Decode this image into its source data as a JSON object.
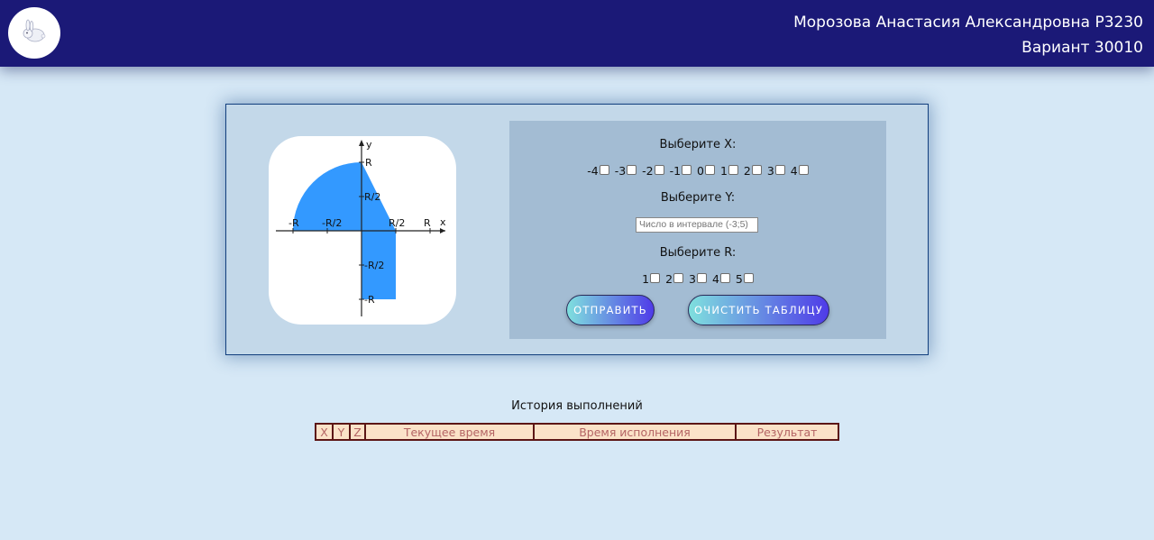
{
  "header": {
    "name": "Морозова Анастасия Александровна P3230",
    "variant": "Вариант 30010",
    "logo_icon": "rabbit-icon"
  },
  "graph": {
    "axis_y": "y",
    "axis_x": "x",
    "label_R_top": "R",
    "label_R2_top": "R/2",
    "label_neg_R": "-R",
    "label_neg_R2_x": "-R/2",
    "label_R2_x": "R/2",
    "label_R_x": "R",
    "label_neg_R2_y": "-R/2",
    "label_neg_R_y": "-R",
    "fill_color": "#3399ff"
  },
  "form": {
    "x_label": "Выберите X:",
    "x_options": [
      "-4",
      "-3",
      "-2",
      "-1",
      "0",
      "1",
      "2",
      "3",
      "4"
    ],
    "y_label": "Выберите Y:",
    "y_placeholder": "Число в интервале (-3;5)",
    "r_label": "Выберите R:",
    "r_options": [
      "1",
      "2",
      "3",
      "4",
      "5"
    ],
    "submit_label": "ОТПРАВИТЬ",
    "clear_label": "ОЧИСТИТЬ ТАБЛИЦУ"
  },
  "history": {
    "title": "История выполнений",
    "columns": [
      "X",
      "Y",
      "Z",
      "Текущее время",
      "Время исполнения",
      "Результат"
    ]
  }
}
